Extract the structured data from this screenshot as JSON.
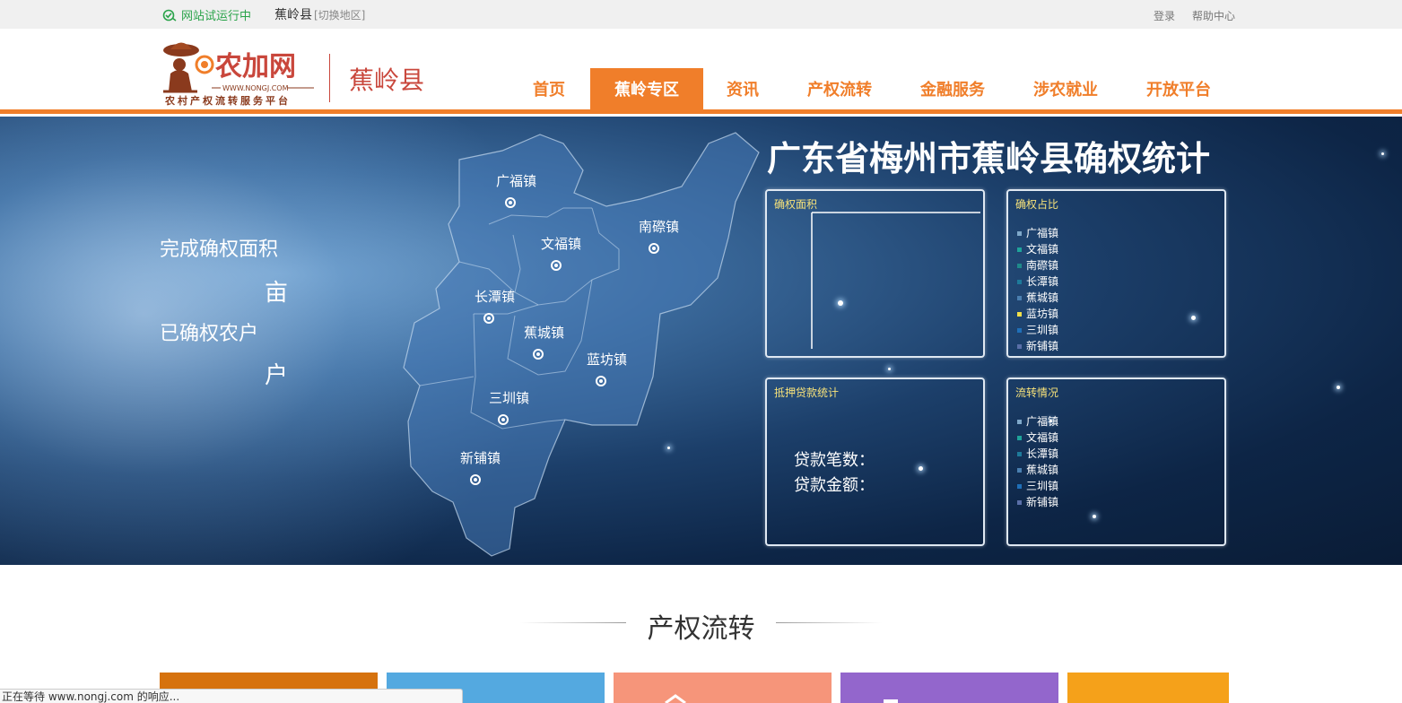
{
  "topbar": {
    "status": "网站试运行中",
    "region": "蕉岭县",
    "switch_region": "[切换地区]",
    "login": "登录",
    "help": "帮助中心"
  },
  "logo": {
    "brand": "农加网",
    "url": "WWW.NONGJ.COM",
    "slogan": "农村产权流转服务平台"
  },
  "county_name": "蕉岭县",
  "nav": [
    {
      "label": "首页",
      "active": false
    },
    {
      "label": "蕉岭专区",
      "active": true
    },
    {
      "label": "资讯",
      "active": false
    },
    {
      "label": "产权流转",
      "active": false
    },
    {
      "label": "金融服务",
      "active": false
    },
    {
      "label": "涉农就业",
      "active": false
    },
    {
      "label": "开放平台",
      "active": false
    }
  ],
  "colors": {
    "accent": "#f07e2a",
    "logo_red": "#c9473c",
    "panel_title": "#f7e27a"
  },
  "stats": {
    "area_label": "完成确权面积",
    "area_unit": "亩",
    "households_label": "已确权农户",
    "households_unit": "户"
  },
  "map": {
    "towns": [
      "广福镇",
      "文福镇",
      "南磜镇",
      "长潭镇",
      "蕉城镇",
      "蓝坊镇",
      "三圳镇",
      "新铺镇"
    ]
  },
  "banner_title": "广东省梅州市蕉岭县确权统计",
  "panels": {
    "area": {
      "title": "确权面积"
    },
    "ratio": {
      "title": "确权占比",
      "legend": [
        {
          "label": "广福镇",
          "color": "#7fa8c9"
        },
        {
          "label": "文福镇",
          "color": "#1fa39a"
        },
        {
          "label": "南磜镇",
          "color": "#1f8a8a"
        },
        {
          "label": "长潭镇",
          "color": "#1e7a9a"
        },
        {
          "label": "蕉城镇",
          "color": "#4a7fb0"
        },
        {
          "label": "蓝坊镇",
          "color": "#f2e04a"
        },
        {
          "label": "三圳镇",
          "color": "#1f6fb8"
        },
        {
          "label": "新铺镇",
          "color": "#5a6fa8"
        }
      ]
    },
    "loan": {
      "title": "抵押贷款统计",
      "count_label": "贷款笔数：",
      "amount_label": "贷款金额："
    },
    "transfer": {
      "title": "流转情况",
      "legend": [
        {
          "label": "广福镇",
          "color": "#7fa8c9"
        },
        {
          "label": "文福镇",
          "color": "#1fa39a"
        },
        {
          "label": "长潭镇",
          "color": "#1e7a9a"
        },
        {
          "label": "蕉城镇",
          "color": "#4a7fb0"
        },
        {
          "label": "三圳镇",
          "color": "#1f6fb8"
        },
        {
          "label": "新铺镇",
          "color": "#5a6fa8"
        }
      ]
    }
  },
  "section": {
    "title": "产权流转"
  },
  "cards": [
    {
      "color": "#d6720e"
    },
    {
      "color": "#54a9e0"
    },
    {
      "color": "#f6957a"
    },
    {
      "color": "#9366cc"
    },
    {
      "color": "#f5a11a"
    }
  ],
  "statusbar": "正在等待 www.nongj.com 的响应..."
}
